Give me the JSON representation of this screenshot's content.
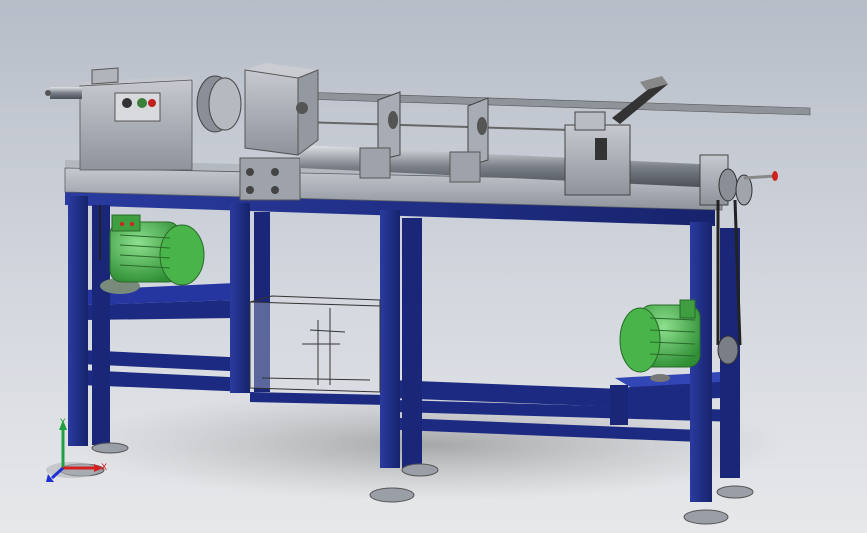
{
  "view": {
    "background_top": "#b7bdc8",
    "background_bottom": "#e7e8ea"
  },
  "model": {
    "frame_color": "#1f2f8c",
    "metal_color": "#a2a6ae",
    "motor_color": "#4fbf4f",
    "handle_color": "#d02020"
  },
  "triad": {
    "x_label": "X",
    "y_label": "Y",
    "x_color": "#d42020",
    "y_color": "#20a040",
    "z_color": "#2030d0"
  }
}
